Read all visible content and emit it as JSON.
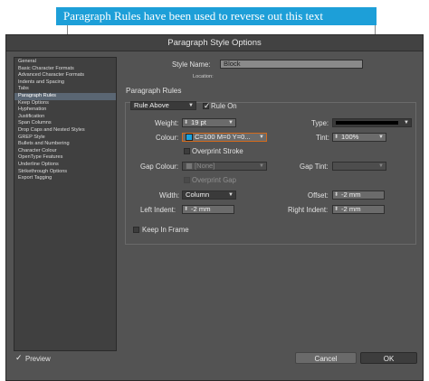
{
  "banner": {
    "text": "Paragraph Rules have been used to reverse out this text"
  },
  "window": {
    "title": "Paragraph Style Options"
  },
  "sidebar": {
    "items": [
      "General",
      "Basic Character Formats",
      "Advanced Character Formats",
      "Indents and Spacing",
      "Tabs",
      "Paragraph Rules",
      "Keep Options",
      "Hyphenation",
      "Justification",
      "Span Columns",
      "Drop Caps and Nested Styles",
      "GREP Style",
      "Bullets and Numbering",
      "Character Colour",
      "OpenType Features",
      "Underline Options",
      "Strikethrough Options",
      "Export Tagging"
    ],
    "selected_index": 5
  },
  "header": {
    "style_name_label": "Style Name:",
    "style_name_value": "Block",
    "location_label": "Location:",
    "section_title": "Paragraph Rules"
  },
  "rule": {
    "position": "Rule Above",
    "rule_on_label": "Rule On",
    "rule_on": true,
    "weight_label": "Weight:",
    "weight": "19 pt",
    "type_label": "Type:",
    "colour_label": "Colour:",
    "colour": "C=100 M=0 Y=0...",
    "tint_label": "Tint:",
    "tint": "100%",
    "overprint_stroke_label": "Overprint Stroke",
    "gap_colour_label": "Gap Colour:",
    "gap_colour": "[None]",
    "gap_tint_label": "Gap Tint:",
    "overprint_gap_label": "Overprint Gap",
    "width_label": "Width:",
    "width": "Column",
    "offset_label": "Offset:",
    "offset": "-2 mm",
    "left_indent_label": "Left Indent:",
    "left_indent": "-2 mm",
    "right_indent_label": "Right Indent:",
    "right_indent": "-2 mm",
    "keep_in_frame_label": "Keep In Frame"
  },
  "footer": {
    "preview_label": "Preview",
    "preview": true,
    "cancel_label": "Cancel",
    "ok_label": "OK"
  },
  "colors": {
    "banner": "#1d9fd8",
    "window_bg": "#535353",
    "selection": "#5a6673",
    "colour_field_border": "#d46a1c",
    "colour_swatch": "#1aa3e0"
  }
}
